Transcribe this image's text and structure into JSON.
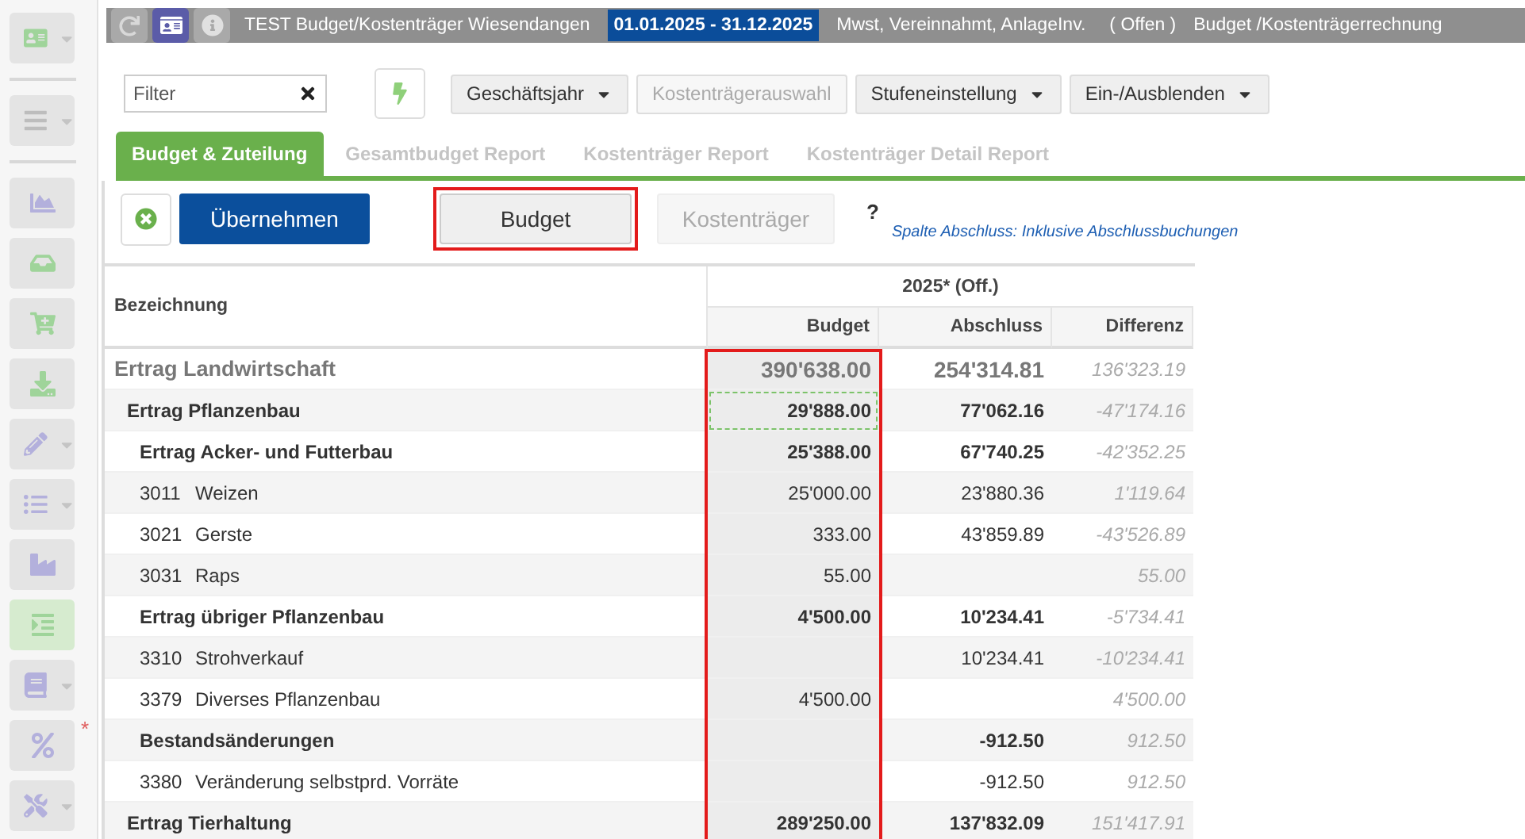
{
  "sidebar": {
    "groups": [
      [
        {
          "dropdown": true,
          "selected": false
        }
      ],
      [
        {
          "dropdown": true,
          "selected": false
        }
      ],
      [
        {
          "dropdown": false,
          "selected": false
        },
        {
          "dropdown": false,
          "selected": false
        },
        {
          "dropdown": false,
          "selected": false
        },
        {
          "dropdown": false,
          "selected": false
        },
        {
          "dropdown": true,
          "selected": false
        },
        {
          "dropdown": true,
          "selected": false
        },
        {
          "dropdown": false,
          "selected": false
        },
        {
          "dropdown": false,
          "selected": true
        },
        {
          "dropdown": true,
          "selected": false
        },
        {
          "dropdown": false,
          "selected": false,
          "badge": "*"
        },
        {
          "dropdown": true,
          "selected": false
        }
      ]
    ]
  },
  "header": {
    "title": "TEST Budget/Kostenträger Wiesendangen",
    "period": "01.01.2025 - 31.12.2025",
    "settings": "Mwst, Vereinnahmt, AnlageInv.",
    "status": "( Offen )",
    "module": "Budget /Kostenträgerrechnung"
  },
  "toolbar": {
    "filter": {
      "placeholder": "Filter"
    },
    "buttons": [
      {
        "label": "Geschäftsjahr",
        "dropdown": true,
        "disabled": false
      },
      {
        "label": "Kostenträgerauswahl",
        "dropdown": false,
        "disabled": true
      },
      {
        "label": "Stufeneinstellung",
        "dropdown": true,
        "disabled": false
      },
      {
        "label": "Ein-/Ausblenden",
        "dropdown": true,
        "disabled": false
      }
    ]
  },
  "tabs": [
    {
      "label": "Budget & Zuteilung",
      "selected": true
    },
    {
      "label": "Gesamtbudget Report",
      "selected": false
    },
    {
      "label": "Kostenträger Report",
      "selected": false
    },
    {
      "label": "Kostenträger Detail Report",
      "selected": false
    }
  ],
  "actions": {
    "apply": "Übernehmen",
    "modes": [
      {
        "label": "Budget",
        "selected": true,
        "highlighted": true
      },
      {
        "label": "Kostenträger",
        "selected": false,
        "highlighted": false
      }
    ],
    "help": "?",
    "note": "Spalte Abschluss: Inklusive Abschlussbuchungen"
  },
  "table": {
    "label_column": "Bezeichnung",
    "group_header": "2025* (Off.)",
    "columns": [
      {
        "label": "Budget",
        "highlighted": true
      },
      {
        "label": "Abschluss",
        "highlighted": false
      },
      {
        "label": "Differenz",
        "highlighted": false
      }
    ],
    "rows": [
      {
        "kind": "total",
        "label": "Ertrag Landwirtschaft",
        "budget": "390'638.00",
        "closing": "254'314.81",
        "difference": "136'323.19",
        "focused": false
      },
      {
        "kind": "group",
        "label": "Ertrag Pflanzenbau",
        "budget": "29'888.00",
        "closing": "77'062.16",
        "difference": "-47'174.16",
        "focused": true
      },
      {
        "kind": "subgroup",
        "label": "Ertrag Acker- und Futterbau",
        "budget": "25'388.00",
        "closing": "67'740.25",
        "difference": "-42'352.25",
        "focused": false
      },
      {
        "kind": "account",
        "number": "3011",
        "label": "Weizen",
        "budget": "25'000.00",
        "closing": "23'880.36",
        "difference": "1'119.64",
        "focused": false
      },
      {
        "kind": "account",
        "number": "3021",
        "label": "Gerste",
        "budget": "333.00",
        "closing": "43'859.89",
        "difference": "-43'526.89",
        "focused": false
      },
      {
        "kind": "account",
        "number": "3031",
        "label": "Raps",
        "budget": "55.00",
        "difference": "55.00",
        "focused": false
      },
      {
        "kind": "subgroup",
        "label": "Ertrag übriger Pflanzenbau",
        "budget": "4'500.00",
        "closing": "10'234.41",
        "difference": "-5'734.41",
        "focused": false
      },
      {
        "kind": "account",
        "number": "3310",
        "label": "Strohverkauf",
        "closing": "10'234.41",
        "difference": "-10'234.41",
        "focused": false
      },
      {
        "kind": "account",
        "number": "3379",
        "label": "Diverses Pflanzenbau",
        "budget": "4'500.00",
        "difference": "4'500.00",
        "focused": false
      },
      {
        "kind": "subgroup",
        "label": "Bestandsänderungen",
        "closing": "-912.50",
        "difference": "912.50",
        "focused": false
      },
      {
        "kind": "account",
        "number": "3380",
        "label": "Veränderung selbstprd. Vorräte",
        "closing": "-912.50",
        "difference": "912.50",
        "focused": false
      },
      {
        "kind": "group",
        "label": "Ertrag Tierhaltung",
        "budget": "289'250.00",
        "closing": "137'832.09",
        "difference": "151'417.91",
        "focused": false
      }
    ]
  }
}
